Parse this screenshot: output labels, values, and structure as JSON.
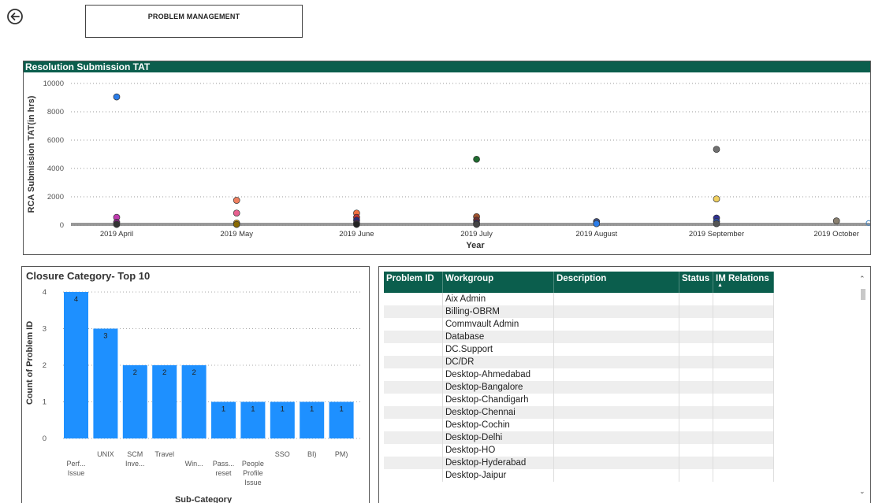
{
  "header": {
    "title": "PROBLEM MANAGEMENT"
  },
  "scatter": {
    "title": "Resolution Submission TAT",
    "chart_data": {
      "type": "scatter",
      "title": "Resolution Submission TAT",
      "xlabel": "Year",
      "ylabel": "RCA Submission TAT(in hrs)",
      "categories": [
        "2019 April",
        "2019 May",
        "2019 June",
        "2019 July",
        "2019 August",
        "2019 September",
        "2019 October"
      ],
      "yticks": [
        0,
        2000,
        4000,
        6000,
        8000,
        10000
      ],
      "ylim": [
        0,
        10500
      ],
      "grid": true,
      "points": [
        {
          "x": "2019 April",
          "y": 9050,
          "color": "#2b7de9"
        },
        {
          "x": "2019 April",
          "y": 550,
          "color": "#c03ab0"
        },
        {
          "x": "2019 April",
          "y": 200,
          "color": "#7a2a7a"
        },
        {
          "x": "2019 April",
          "y": 50,
          "color": "#333333"
        },
        {
          "x": "2019 May",
          "y": 1750,
          "color": "#f08060"
        },
        {
          "x": "2019 May",
          "y": 850,
          "color": "#e86090"
        },
        {
          "x": "2019 May",
          "y": 150,
          "color": "#d4a020"
        },
        {
          "x": "2019 May",
          "y": 50,
          "color": "#8a6a00"
        },
        {
          "x": "2019 June",
          "y": 850,
          "color": "#f07040"
        },
        {
          "x": "2019 June",
          "y": 550,
          "color": "#c03030"
        },
        {
          "x": "2019 June",
          "y": 350,
          "color": "#2a2a7a"
        },
        {
          "x": "2019 June",
          "y": 150,
          "color": "#4a2a4a"
        },
        {
          "x": "2019 June",
          "y": 50,
          "color": "#222222"
        },
        {
          "x": "2019 July",
          "y": 4650,
          "color": "#1f6b2f"
        },
        {
          "x": "2019 July",
          "y": 600,
          "color": "#a0522d"
        },
        {
          "x": "2019 July",
          "y": 350,
          "color": "#703030"
        },
        {
          "x": "2019 July",
          "y": 150,
          "color": "#303060"
        },
        {
          "x": "2019 July",
          "y": 50,
          "color": "#444444"
        },
        {
          "x": "2019 August",
          "y": 250,
          "color": "#405080"
        },
        {
          "x": "2019 August",
          "y": 100,
          "color": "#2b7de9"
        },
        {
          "x": "2019 September",
          "y": 5350,
          "color": "#707070"
        },
        {
          "x": "2019 September",
          "y": 1850,
          "color": "#f0d060"
        },
        {
          "x": "2019 September",
          "y": 500,
          "color": "#303090"
        },
        {
          "x": "2019 September",
          "y": 250,
          "color": "#2b4da9"
        },
        {
          "x": "2019 September",
          "y": 100,
          "color": "#555555"
        },
        {
          "x": "2019 October",
          "y": 300,
          "color": "#8a8070"
        }
      ]
    }
  },
  "bar": {
    "title": "Closure Category- Top 10",
    "chart_data": {
      "type": "bar",
      "title": "Closure Category- Top 10",
      "xlabel": "Sub-Category",
      "ylabel": "Count of Problem ID",
      "yticks": [
        0,
        1,
        2,
        3,
        4
      ],
      "ylim": [
        0,
        4.3
      ],
      "grid": true,
      "color": "#1e90ff",
      "categories": [
        [
          "Perf...",
          "Issue"
        ],
        [
          "UNIX"
        ],
        [
          "SCM",
          "Inve..."
        ],
        [
          "Travel"
        ],
        [
          "Win..."
        ],
        [
          "Pass...",
          "reset"
        ],
        [
          "People",
          "Profile",
          "Issue"
        ],
        [
          "SSO"
        ],
        [
          "BI)"
        ],
        [
          "PM)"
        ]
      ],
      "label_offsets": [
        1,
        0,
        0,
        0,
        1,
        1,
        1,
        0,
        0,
        0
      ],
      "values": [
        4,
        3,
        2,
        2,
        2,
        1,
        1,
        1,
        1,
        1
      ]
    }
  },
  "table": {
    "columns": [
      "Problem ID",
      "Workgroup",
      "Description",
      "Status",
      "IM Relations"
    ],
    "rows": [
      "Aix Admin",
      "Billing-OBRM",
      "Commvault Admin",
      "Database",
      "DC.Support",
      "DC/DR",
      "Desktop-Ahmedabad",
      "Desktop-Bangalore",
      "Desktop-Chandigarh",
      "Desktop-Chennai",
      "Desktop-Cochin",
      "Desktop-Delhi",
      "Desktop-HO",
      "Desktop-Hyderabad",
      "Desktop-Jaipur"
    ],
    "scroll_up_icon": "chevron-up-icon",
    "scroll_down_icon": "chevron-down-icon"
  },
  "colors": {
    "header_green": "#0b5e4d",
    "bar_blue": "#1e90ff"
  }
}
